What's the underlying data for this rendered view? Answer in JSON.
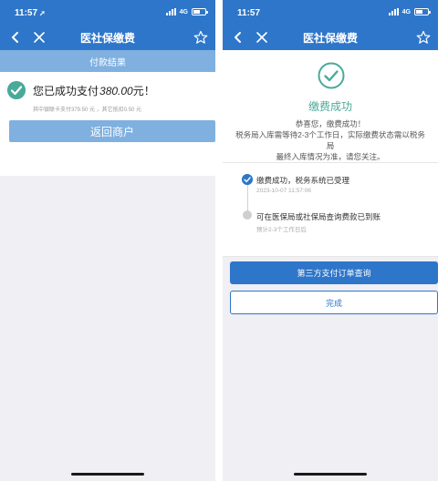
{
  "left": {
    "status": {
      "time": "11:57",
      "network": "4G"
    },
    "nav": {
      "title": "医社保缴费"
    },
    "band_title": "付款结果",
    "success": {
      "prefix": "您已成功支付",
      "amount": "380.00",
      "suffix": "元！"
    },
    "detail": "其中银联卡支付379.50 元 ，其它抵扣0.50 元",
    "return_button": "返回商户"
  },
  "right": {
    "status": {
      "time": "11:57",
      "network": "4G"
    },
    "nav": {
      "title": "医社保缴费"
    },
    "success_title": "缴费成功",
    "success_msg": {
      "line1": "恭喜您，缴费成功！",
      "line2": "税务局入库需等待2-3个工作日，实际缴费状态需以税务局",
      "line3": "最终入库情况为准，请您关注。"
    },
    "timeline": [
      {
        "title": "缴费成功，税务系统已受理",
        "sub": "2023-10-07 11:57:06",
        "state": "done"
      },
      {
        "title": "可在医保局或社保局查询费款已到账",
        "sub": "预计2-3个工作日后",
        "state": "pending"
      }
    ],
    "query_button": "第三方支付订单查询",
    "done_button": "完成"
  },
  "colors": {
    "brand_blue": "#2e76c9",
    "light_blue": "#7fb0df",
    "success_green": "#4aaa9a"
  },
  "icons": [
    "back-icon",
    "close-icon",
    "star-icon",
    "check-circle-icon"
  ]
}
